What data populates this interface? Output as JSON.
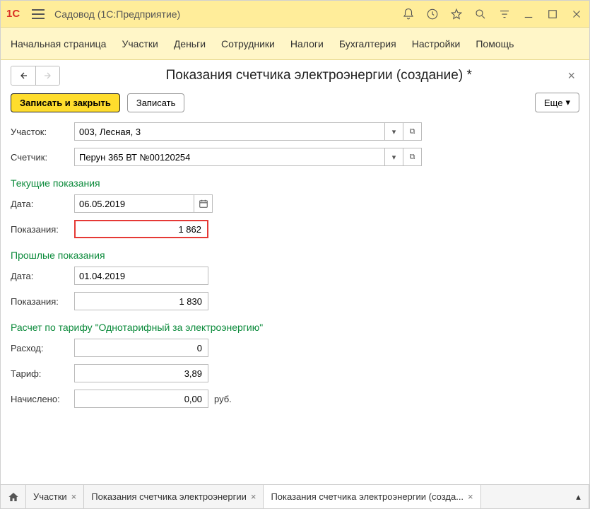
{
  "titlebar": {
    "app_name": "Садовод  (1С:Предприятие)"
  },
  "menu": {
    "items": [
      "Начальная страница",
      "Участки",
      "Деньги",
      "Сотрудники",
      "Налоги",
      "Бухгалтерия",
      "Настройки",
      "Помощь"
    ]
  },
  "form": {
    "title": "Показания счетчика электроэнергии (создание) *",
    "save_close": "Записать и закрыть",
    "save": "Записать",
    "more": "Еще",
    "plot_label": "Участок:",
    "plot_value": "003, Лесная, 3",
    "meter_label": "Счетчик:",
    "meter_value": "Перун 365 ВТ №00120254",
    "current_section": "Текущие показания",
    "date_label": "Дата:",
    "current_date": "06.05.2019",
    "reading_label": "Показания:",
    "current_reading": "1 862",
    "prev_section": "Прошлые показания",
    "prev_date": "01.04.2019",
    "prev_reading": "1 830",
    "tariff_section": "Расчет по тарифу \"Однотарифный за электроэнергию\"",
    "consumption_label": "Расход:",
    "consumption": "0",
    "tariff_label": "Тариф:",
    "tariff": "3,89",
    "charged_label": "Начислено:",
    "charged": "0,00",
    "unit": "руб."
  },
  "tabs": {
    "items": [
      {
        "label": "Участки",
        "close": true
      },
      {
        "label": "Показания счетчика электроэнергии",
        "close": true
      },
      {
        "label": "Показания счетчика электроэнергии (созда...",
        "close": true,
        "active": true
      }
    ]
  }
}
